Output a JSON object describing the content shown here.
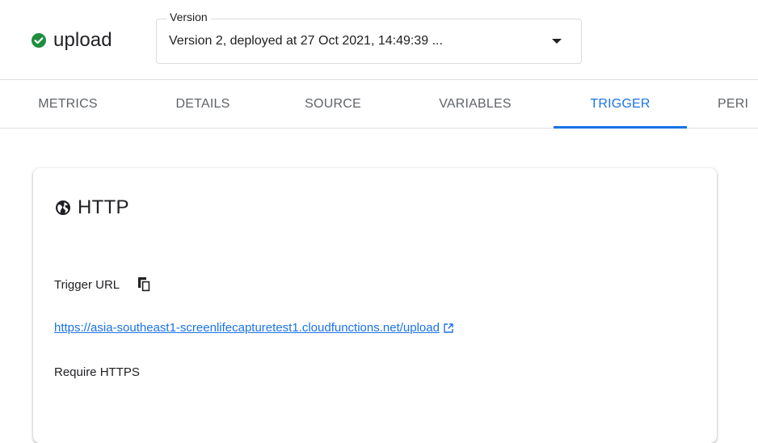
{
  "header": {
    "function_name": "upload",
    "status_icon": "check-circle-icon",
    "status_color": "#1e8e3e"
  },
  "version": {
    "label": "Version",
    "value": "Version 2, deployed at 27 Oct 2021, 14:49:39 ..."
  },
  "tabs": [
    {
      "label": "METRICS",
      "active": false
    },
    {
      "label": "DETAILS",
      "active": false
    },
    {
      "label": "SOURCE",
      "active": false
    },
    {
      "label": "VARIABLES",
      "active": false
    },
    {
      "label": "TRIGGER",
      "active": true
    },
    {
      "label": "PERI",
      "active": false
    }
  ],
  "card": {
    "title": "HTTP",
    "icon": "globe-icon",
    "trigger_url_label": "Trigger URL",
    "trigger_url": "https://asia-southeast1-screenlifecapturetest1.cloudfunctions.net/upload",
    "require_https": "Require HTTPS"
  },
  "colors": {
    "accent": "#1a73e8",
    "text": "#202124",
    "muted": "#5f6368",
    "success": "#1e8e3e"
  }
}
